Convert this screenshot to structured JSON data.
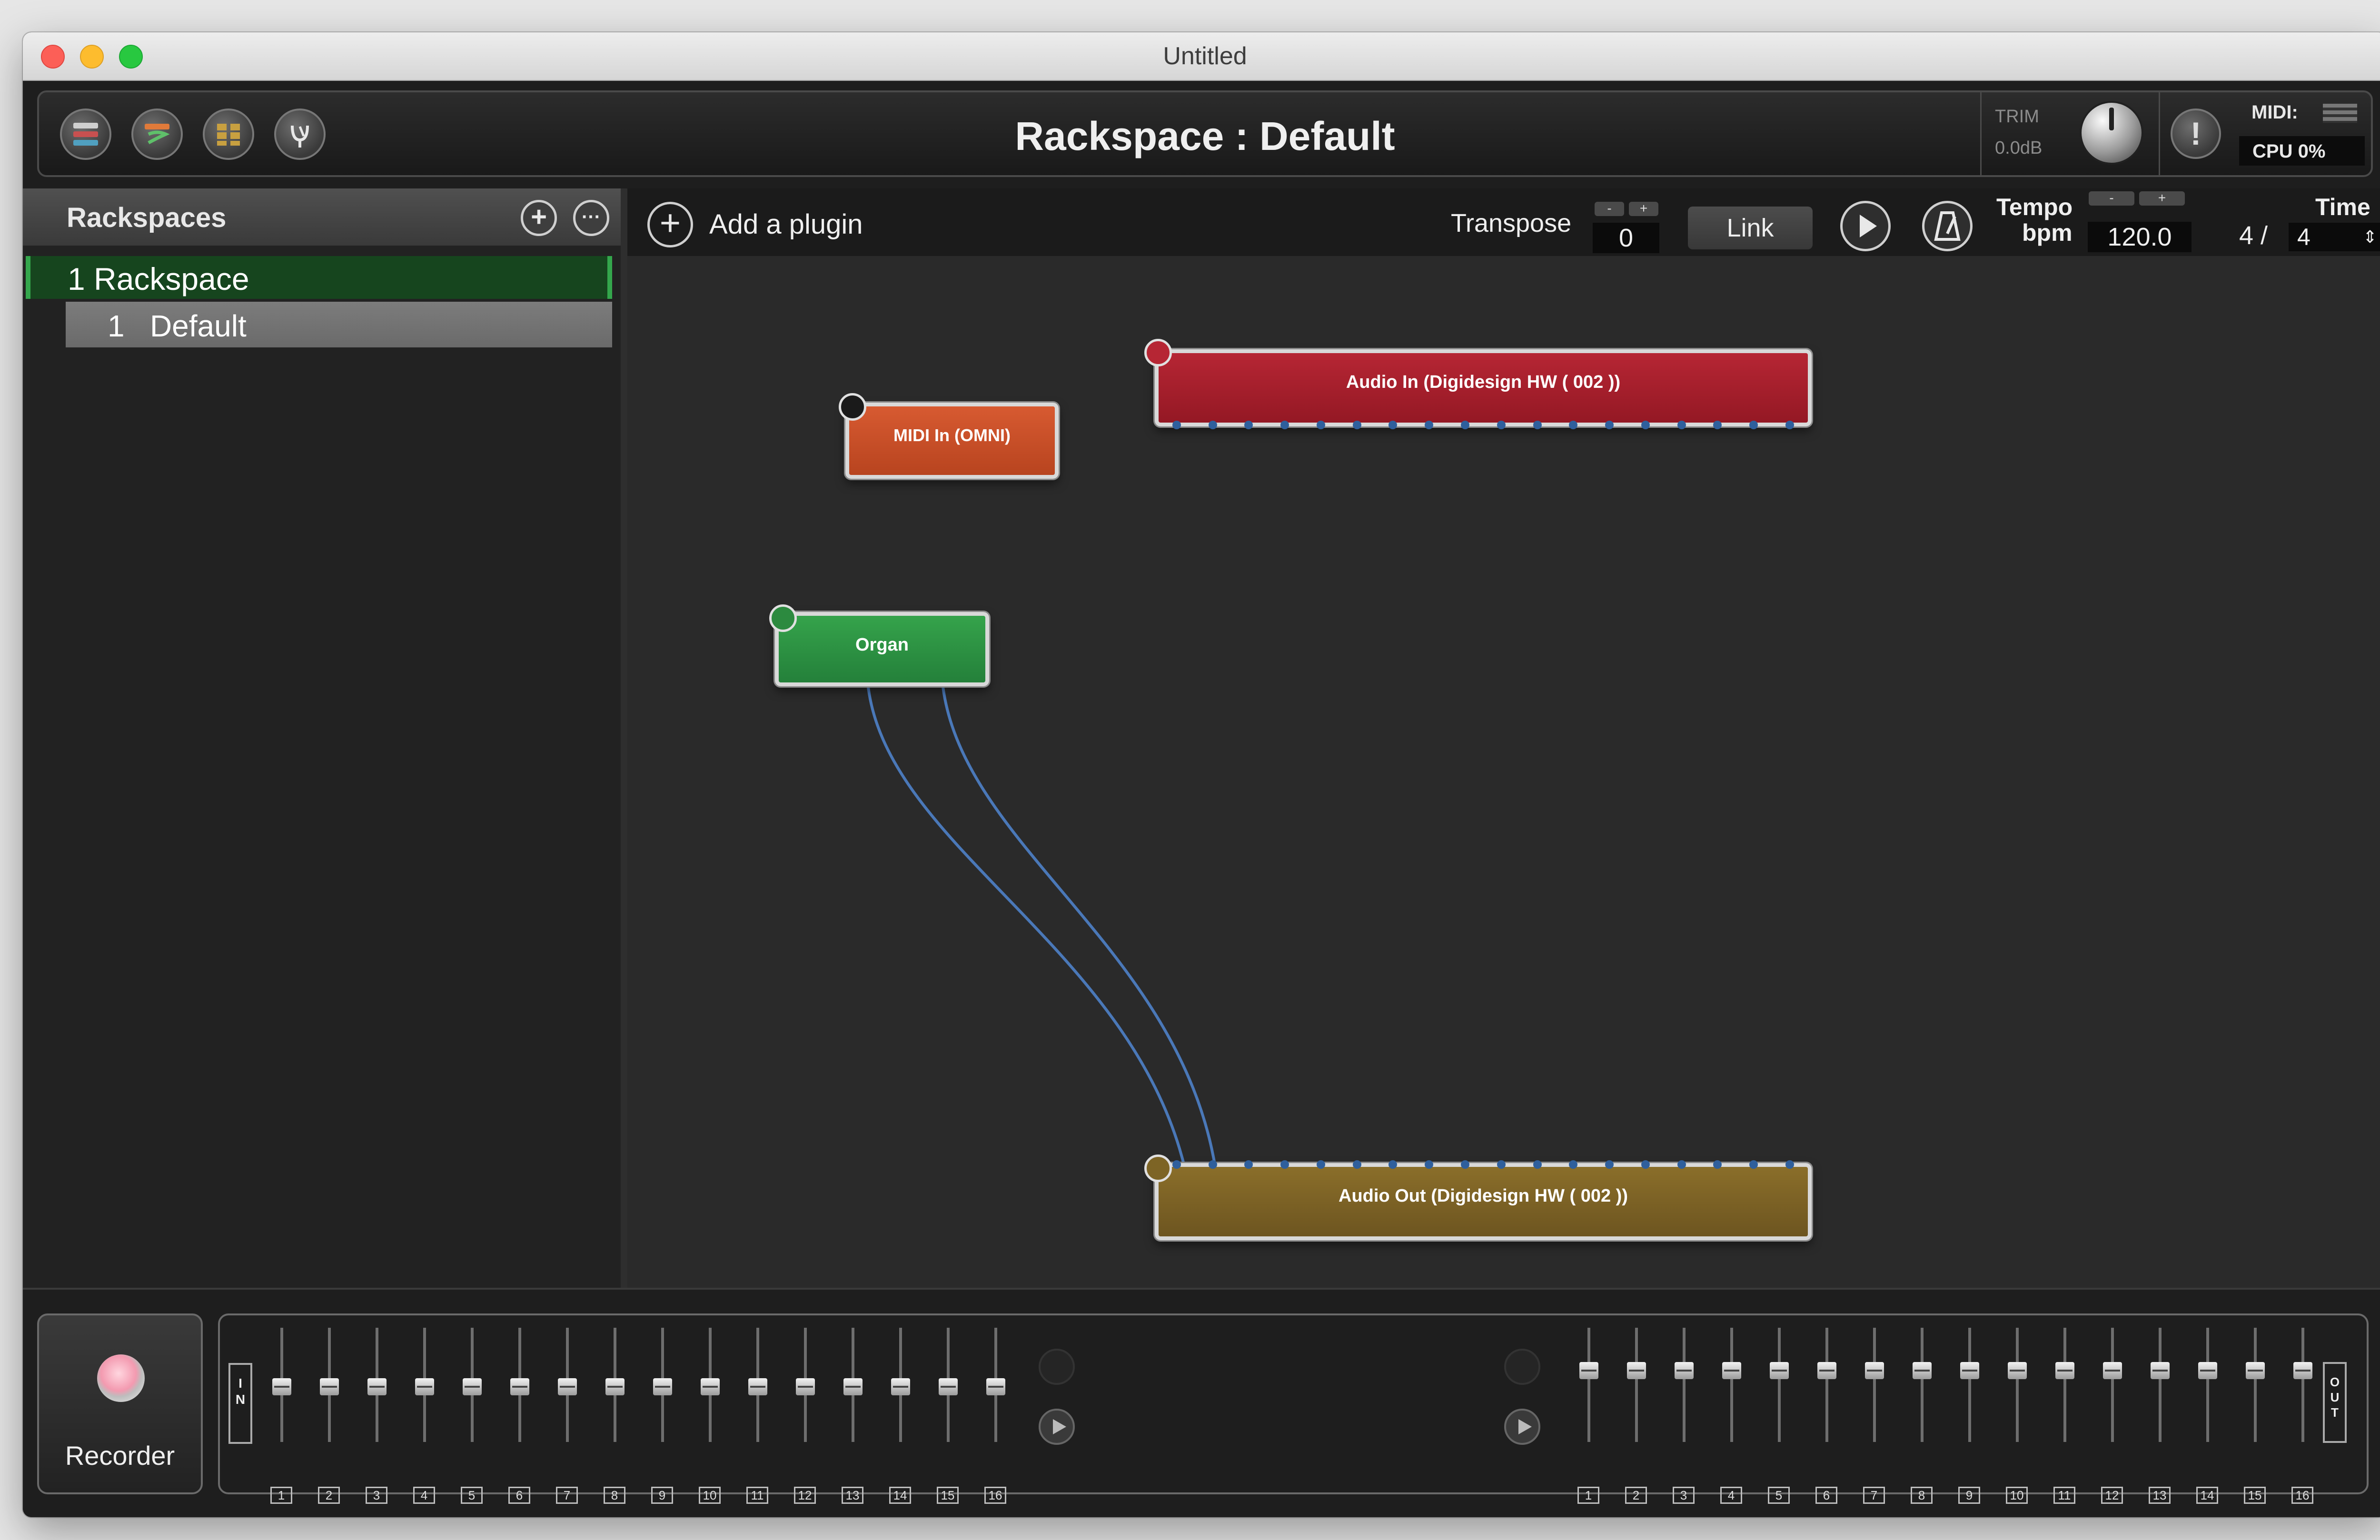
{
  "window": {
    "title": "Untitled"
  },
  "header": {
    "title": "Rackspace : Default",
    "trim_label": "TRIM",
    "trim_value": "0.0dB",
    "panic_symbol": "!",
    "midi_label": "MIDI:",
    "cpu_label": "CPU  0%",
    "buttons": [
      "rackspaces-view-icon",
      "setlist-view-icon",
      "panels-view-icon",
      "tuner-icon"
    ]
  },
  "rackspaces": {
    "header_label": "Rackspaces",
    "add_symbol": "+",
    "more_symbol": "···",
    "items": [
      {
        "label": "1 Rackspace",
        "variations": [
          {
            "label": "1   Default"
          }
        ]
      }
    ]
  },
  "toolbar": {
    "add_symbol": "+",
    "add_plugin_label": "Add a plugin",
    "transpose_label": "Transpose",
    "transpose_value": "0",
    "minus": "-",
    "plus": "+",
    "link_label": "Link",
    "tempo_label": "Tempo",
    "bpm_label": "bpm",
    "tempo_value": "120.0",
    "time_label": "Time",
    "time_numerator": "4 /",
    "time_denominator": "4"
  },
  "colors": {
    "audio_in": "#a41f2b",
    "midi_in": "#c8502b",
    "organ": "#2c8a3f",
    "audio_out": "#7d6425",
    "wire": "#4a78b8",
    "active_rackspace": "#16451e"
  },
  "nodes": {
    "audio_in": {
      "label": "Audio In (Digidesign HW ( 002 ))"
    },
    "midi_in": {
      "label": "MIDI In (OMNI)"
    },
    "organ": {
      "label": "Organ"
    },
    "audio_out": {
      "label": "Audio Out (Digidesign HW ( 002 ))"
    }
  },
  "bottom": {
    "recorder_label": "Recorder",
    "in_label": "I\nN",
    "out_label": "O\nU\nT",
    "input_channels": [
      "1",
      "2",
      "3",
      "4",
      "5",
      "6",
      "7",
      "8",
      "9",
      "10",
      "11",
      "12",
      "13",
      "14",
      "15",
      "16"
    ],
    "output_channels": [
      "1",
      "2",
      "3",
      "4",
      "5",
      "6",
      "7",
      "8",
      "9",
      "10",
      "11",
      "12",
      "13",
      "14",
      "15",
      "16"
    ]
  }
}
